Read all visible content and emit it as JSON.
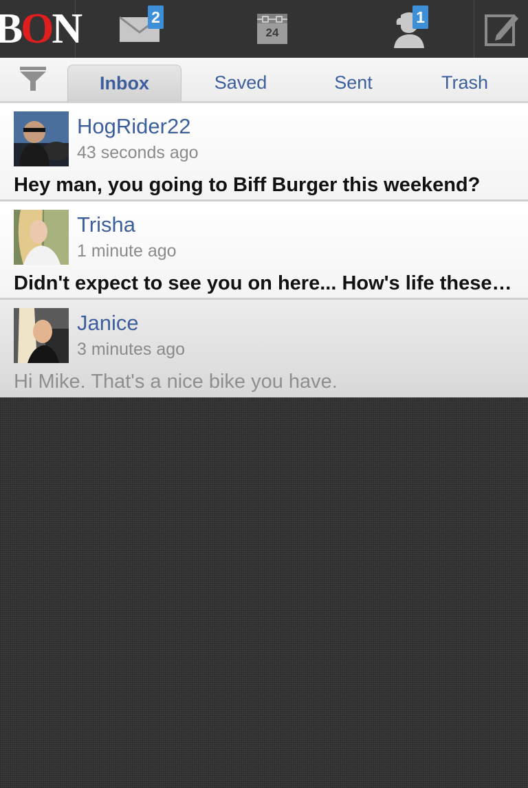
{
  "app": {
    "logo": {
      "part1": "B",
      "part2": "O",
      "part3": "N"
    }
  },
  "topbar": {
    "icons": [
      {
        "name": "mail-icon",
        "badge": "2"
      },
      {
        "name": "calendar-icon",
        "label": "24"
      },
      {
        "name": "profile-icon",
        "badge": "1"
      },
      {
        "name": "compose-icon"
      }
    ]
  },
  "tabs": {
    "filter_icon": "filter-icon",
    "items": [
      {
        "label": "Inbox",
        "active": true
      },
      {
        "label": "Saved",
        "active": false
      },
      {
        "label": "Sent",
        "active": false
      },
      {
        "label": "Trash",
        "active": false
      }
    ]
  },
  "messages": [
    {
      "sender": "HogRider22",
      "time": "43 seconds ago",
      "preview": "Hey man, you going to Biff Burger this weekend?",
      "unread": true
    },
    {
      "sender": "Trisha",
      "time": "1 minute ago",
      "preview": "Didn't expect to see you on here... How's life these days?",
      "unread": true
    },
    {
      "sender": "Janice",
      "time": "3 minutes ago",
      "preview": "Hi Mike. That's a nice bike you have.",
      "unread": false
    }
  ],
  "colors": {
    "accent_blue": "#3c5f9c",
    "badge_blue": "#3d8fd8",
    "logo_red": "#e01e1e",
    "topbar_bg": "#333333"
  }
}
